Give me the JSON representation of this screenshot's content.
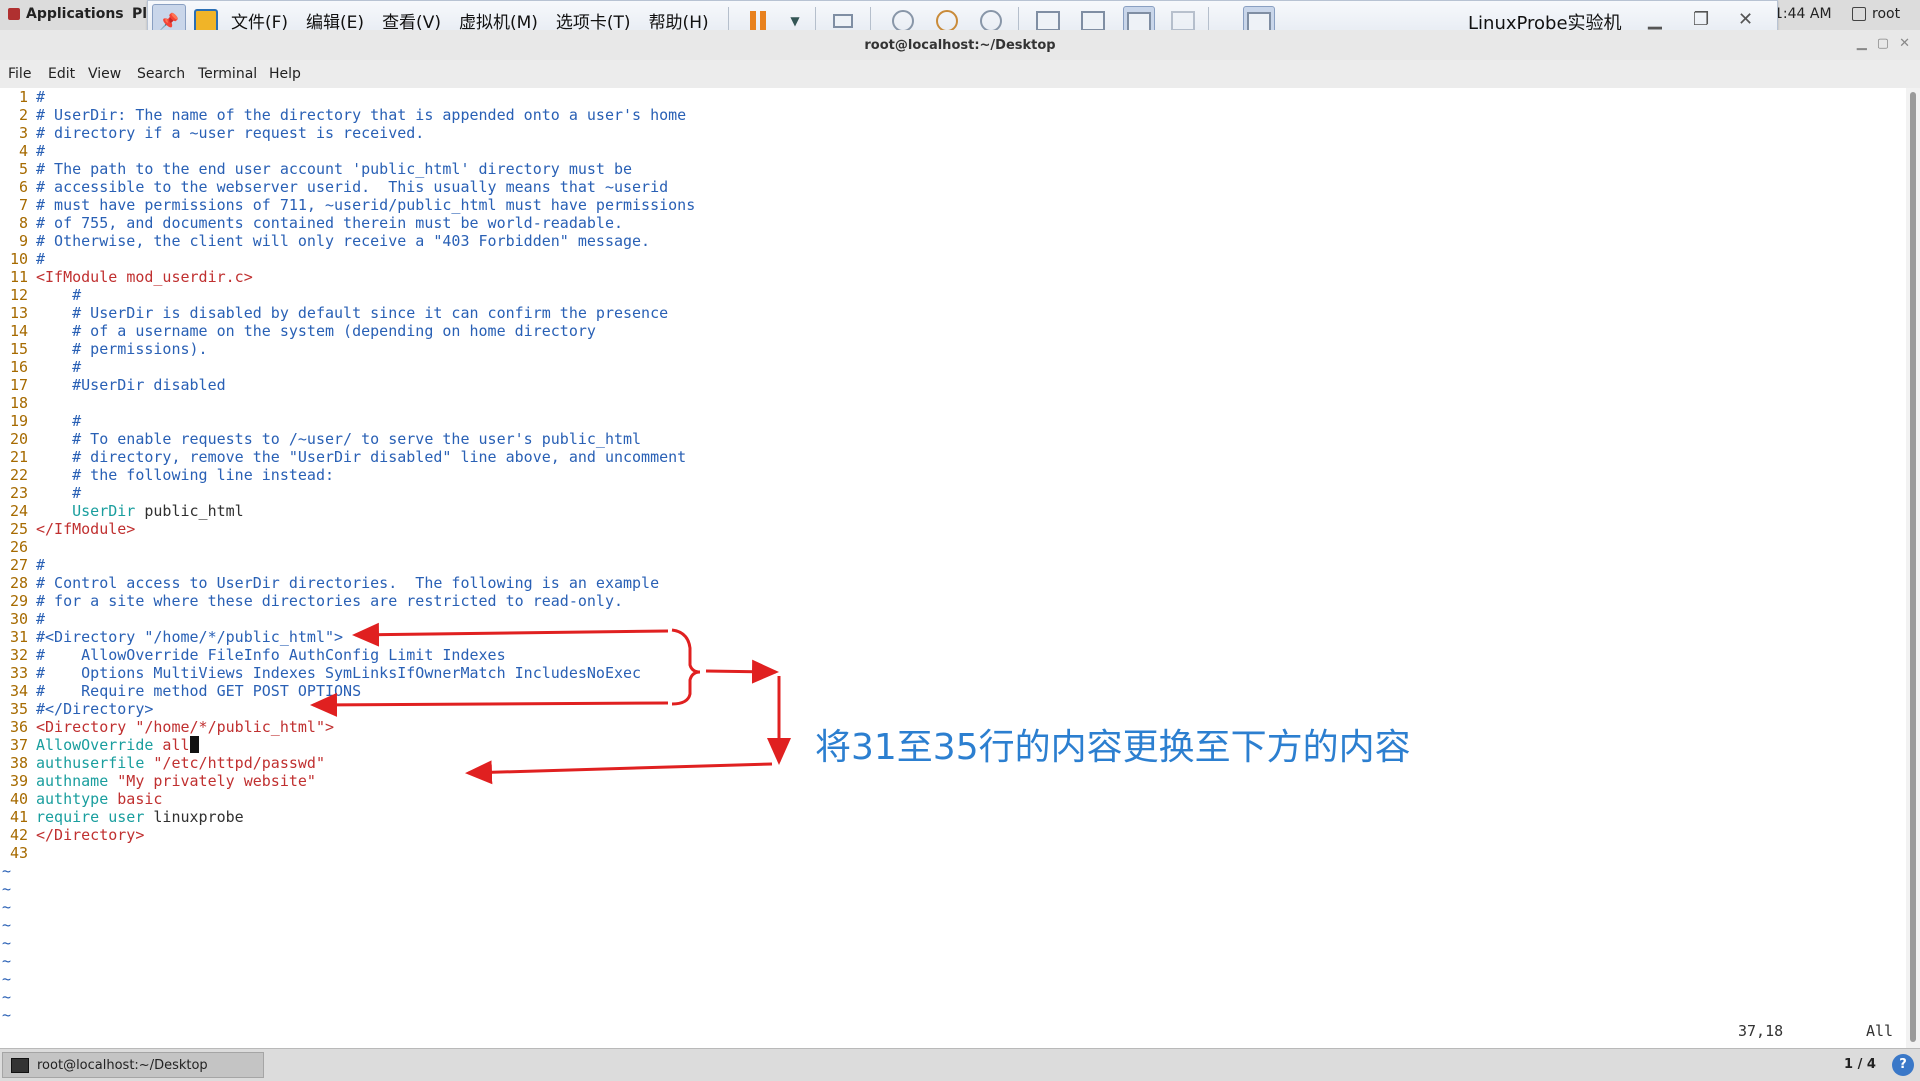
{
  "topbar": {
    "applications": "Applications",
    "places": "Pl",
    "clock": "1:44 AM",
    "user": "root"
  },
  "vmware": {
    "menu": [
      "文件(F)",
      "编辑(E)",
      "查看(V)",
      "虚拟机(M)",
      "选项卡(T)",
      "帮助(H)"
    ],
    "title": "LinuxProbe实验机"
  },
  "window": {
    "title": "root@localhost:~/Desktop",
    "menu": [
      "File",
      "Edit",
      "View",
      "Search",
      "Terminal",
      "Help"
    ]
  },
  "editor": {
    "lines": [
      {
        "n": "1",
        "parts": [
          {
            "c": "c",
            "t": "#"
          }
        ]
      },
      {
        "n": "2",
        "parts": [
          {
            "c": "c",
            "t": "# UserDir: The name of the directory that is appended onto a user's home"
          }
        ]
      },
      {
        "n": "3",
        "parts": [
          {
            "c": "c",
            "t": "# directory if a ~user request is received."
          }
        ]
      },
      {
        "n": "4",
        "parts": [
          {
            "c": "c",
            "t": "#"
          }
        ]
      },
      {
        "n": "5",
        "parts": [
          {
            "c": "c",
            "t": "# The path to the end user account 'public_html' directory must be"
          }
        ]
      },
      {
        "n": "6",
        "parts": [
          {
            "c": "c",
            "t": "# accessible to the webserver userid.  This usually means that ~userid"
          }
        ]
      },
      {
        "n": "7",
        "parts": [
          {
            "c": "c",
            "t": "# must have permissions of 711, ~userid/public_html must have permissions"
          }
        ]
      },
      {
        "n": "8",
        "parts": [
          {
            "c": "c",
            "t": "# of 755, and documents contained therein must be world-readable."
          }
        ]
      },
      {
        "n": "9",
        "parts": [
          {
            "c": "c",
            "t": "# Otherwise, the client will only receive a \"403 Forbidden\" message."
          }
        ]
      },
      {
        "n": "10",
        "parts": [
          {
            "c": "c",
            "t": "#"
          }
        ]
      },
      {
        "n": "11",
        "parts": [
          {
            "c": "s",
            "t": "<IfModule "
          },
          {
            "c": "s",
            "t": "mod_userdir.c"
          },
          {
            "c": "s",
            "t": ">"
          }
        ]
      },
      {
        "n": "12",
        "parts": [
          {
            "c": "c",
            "t": "    #"
          }
        ]
      },
      {
        "n": "13",
        "parts": [
          {
            "c": "c",
            "t": "    # UserDir is disabled by default since it can confirm the presence"
          }
        ]
      },
      {
        "n": "14",
        "parts": [
          {
            "c": "c",
            "t": "    # of a username on the system (depending on home directory"
          }
        ]
      },
      {
        "n": "15",
        "parts": [
          {
            "c": "c",
            "t": "    # permissions)."
          }
        ]
      },
      {
        "n": "16",
        "parts": [
          {
            "c": "c",
            "t": "    #"
          }
        ]
      },
      {
        "n": "17",
        "parts": [
          {
            "c": "c",
            "t": "    #UserDir disabled"
          }
        ]
      },
      {
        "n": "18",
        "parts": []
      },
      {
        "n": "19",
        "parts": [
          {
            "c": "c",
            "t": "    #"
          }
        ]
      },
      {
        "n": "20",
        "parts": [
          {
            "c": "c",
            "t": "    # To enable requests to /~user/ to serve the user's public_html"
          }
        ]
      },
      {
        "n": "21",
        "parts": [
          {
            "c": "c",
            "t": "    # directory, remove the \"UserDir disabled\" line above, and uncomment"
          }
        ]
      },
      {
        "n": "22",
        "parts": [
          {
            "c": "c",
            "t": "    # the following line instead:"
          }
        ]
      },
      {
        "n": "23",
        "parts": [
          {
            "c": "c",
            "t": "    #"
          }
        ]
      },
      {
        "n": "24",
        "parts": [
          {
            "c": "k",
            "t": "    UserDir"
          },
          {
            "c": "",
            "t": " public_html"
          }
        ]
      },
      {
        "n": "25",
        "parts": [
          {
            "c": "s",
            "t": "</IfModule>"
          }
        ]
      },
      {
        "n": "26",
        "parts": []
      },
      {
        "n": "27",
        "parts": [
          {
            "c": "c",
            "t": "#"
          }
        ]
      },
      {
        "n": "28",
        "parts": [
          {
            "c": "c",
            "t": "# Control access to UserDir directories.  The following is an example"
          }
        ]
      },
      {
        "n": "29",
        "parts": [
          {
            "c": "c",
            "t": "# for a site where these directories are restricted to read-only."
          }
        ]
      },
      {
        "n": "30",
        "parts": [
          {
            "c": "c",
            "t": "#"
          }
        ]
      },
      {
        "n": "31",
        "parts": [
          {
            "c": "c",
            "t": "#<Directory \"/home/*/public_html\">"
          }
        ]
      },
      {
        "n": "32",
        "parts": [
          {
            "c": "c",
            "t": "#    AllowOverride FileInfo AuthConfig Limit Indexes"
          }
        ]
      },
      {
        "n": "33",
        "parts": [
          {
            "c": "c",
            "t": "#    Options MultiViews Indexes SymLinksIfOwnerMatch IncludesNoExec"
          }
        ]
      },
      {
        "n": "34",
        "parts": [
          {
            "c": "c",
            "t": "#    Require method GET POST OPTIONS"
          }
        ]
      },
      {
        "n": "35",
        "parts": [
          {
            "c": "c",
            "t": "#</Directory>"
          }
        ]
      },
      {
        "n": "36",
        "parts": [
          {
            "c": "s",
            "t": "<Directory \"/home/*/public_html\">"
          }
        ]
      },
      {
        "n": "37",
        "parts": [
          {
            "c": "k",
            "t": "AllowOverride"
          },
          {
            "c": "s",
            "t": " all"
          }
        ],
        "cursor": true
      },
      {
        "n": "38",
        "parts": [
          {
            "c": "k",
            "t": "authuserfile"
          },
          {
            "c": "s",
            "t": " \"/etc/httpd/passwd\""
          }
        ]
      },
      {
        "n": "39",
        "parts": [
          {
            "c": "k",
            "t": "authname"
          },
          {
            "c": "s",
            "t": " \"My privately website\""
          }
        ]
      },
      {
        "n": "40",
        "parts": [
          {
            "c": "k",
            "t": "authtype"
          },
          {
            "c": "s",
            "t": " basic"
          }
        ]
      },
      {
        "n": "41",
        "parts": [
          {
            "c": "k",
            "t": "require user"
          },
          {
            "c": "",
            "t": " linuxprobe"
          }
        ]
      },
      {
        "n": "42",
        "parts": [
          {
            "c": "s",
            "t": "</Directory>"
          }
        ]
      },
      {
        "n": "43",
        "parts": []
      }
    ],
    "tilde": "~",
    "position": "37,18",
    "range": "All"
  },
  "annotation": "将31至35行的内容更换至下方的内容",
  "taskbar": {
    "task": "root@localhost:~/Desktop",
    "pages": "1 / 4",
    "help": "?"
  },
  "colors": {
    "comment": "#2960b5",
    "string": "#c03030",
    "keyword": "#199e9e",
    "line_number": "#a66a00",
    "annotation": "#2c7fd0",
    "arrow": "#e02020"
  }
}
